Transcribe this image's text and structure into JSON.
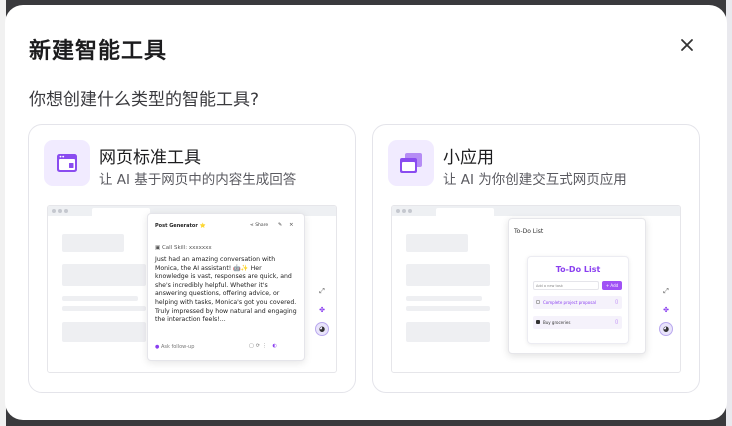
{
  "dialog": {
    "title": "新建智能工具",
    "subtitle": "你想创建什么类型的智能工具?",
    "close_icon": "close-icon"
  },
  "cards": [
    {
      "name": "网页标准工具",
      "description": "让 AI 基于网页中的内容生成回答",
      "icon": "browser-window-icon",
      "preview": {
        "popup_title": "Post Generator ⭐",
        "share": "Share",
        "skill": "Call Skill: xxxxxxx",
        "body": "Just had an amazing conversation with Monica, the AI assistant! 🤖✨ Her knowledge is vast, responses are quick, and she's incredibly helpful. Whether it's answering questions, offering advice, or helping with tasks, Monica's got you covered. Truly impressed by how natural and engaging the interaction feels!...",
        "follow_up": "Ask follow-up"
      }
    },
    {
      "name": "小应用",
      "description": "让 AI 为你创建交互式网页应用",
      "icon": "app-windows-icon",
      "preview": {
        "window_title": "To-Do List",
        "app_title": "To-Do List",
        "input_placeholder": "Add a new task",
        "add_label": "+ Add",
        "items": [
          {
            "text": "Complete project proposal",
            "done": false
          },
          {
            "text": "Buy groceries",
            "done": true
          }
        ]
      }
    }
  ],
  "colors": {
    "accent": "#8a3ff0",
    "icon_bg": "#f1ebff"
  }
}
